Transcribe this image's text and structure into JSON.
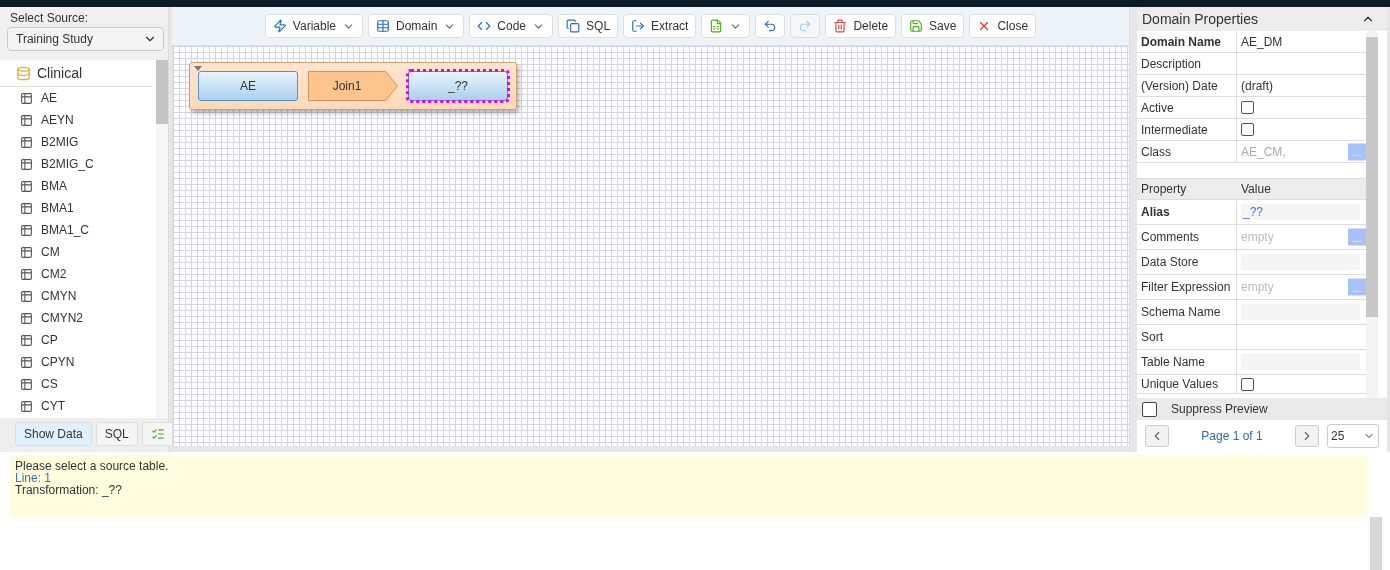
{
  "source": {
    "label": "Select Source:",
    "value": "Training Study",
    "group": "Clinical",
    "tables": [
      "AE",
      "AEYN",
      "B2MIG",
      "B2MIG_C",
      "BMA",
      "BMA1",
      "BMA1_C",
      "CM",
      "CM2",
      "CMYN",
      "CMYN2",
      "CP",
      "CPYN",
      "CS",
      "CYT"
    ],
    "buttons": [
      {
        "label": "Show Data",
        "selected": true
      },
      {
        "label": "SQL",
        "selected": false
      },
      {
        "selected": false
      }
    ]
  },
  "toolbar": [
    {
      "label": "Variable",
      "dropdown": true,
      "disabled": false
    },
    {
      "label": "Domain",
      "dropdown": true,
      "disabled": false
    },
    {
      "label": "Code",
      "dropdown": true,
      "disabled": false
    },
    {
      "label": "SQL",
      "dropdown": false,
      "disabled": false
    },
    {
      "label": "Extract",
      "dropdown": false,
      "disabled": false
    },
    {
      "dropdown": true,
      "disabled": false
    },
    {
      "dropdown": false,
      "disabled": false
    },
    {
      "dropdown": false,
      "disabled": true
    },
    {
      "label": "Delete",
      "dropdown": false,
      "disabled": false
    },
    {
      "label": "Save",
      "dropdown": false,
      "disabled": false
    },
    {
      "label": "Close",
      "dropdown": false,
      "disabled": false
    }
  ],
  "flow": [
    {
      "kind": "table",
      "label": "AE",
      "selected": false
    },
    {
      "kind": "join",
      "label": "Join1",
      "selected": false
    },
    {
      "kind": "table",
      "label": "_??",
      "selected": true
    }
  ],
  "properties": {
    "title": "Domain Properties",
    "expanded": true,
    "domain_rows": [
      {
        "label": "Domain Name",
        "kind": "text",
        "value": "AE_DM",
        "bold": true
      },
      {
        "label": "Description",
        "kind": "text",
        "value": "",
        "bold": false
      },
      {
        "label": "(Version) Date",
        "kind": "text",
        "value": "(draft)",
        "bold": false
      },
      {
        "label": "Active",
        "kind": "checkbox",
        "checked": false,
        "bold": false
      },
      {
        "label": "Intermediate",
        "kind": "checkbox",
        "checked": false,
        "bold": false
      },
      {
        "label": "Class",
        "kind": "lookup",
        "value": "AE_CM,",
        "button": "...",
        "bold": false
      }
    ],
    "columns": [
      "Property",
      "Value"
    ],
    "rows": [
      {
        "label": "Alias",
        "kind": "input",
        "value": "_??",
        "bold": true
      },
      {
        "label": "Comments",
        "kind": "lookup",
        "placeholder": "empty",
        "button": "...",
        "bold": false
      },
      {
        "label": "Data Store",
        "kind": "input",
        "value": "",
        "bold": false
      },
      {
        "label": "Filter Expression",
        "kind": "lookup",
        "placeholder": "empty",
        "button": "...",
        "bold": false
      },
      {
        "label": "Schema Name",
        "kind": "input",
        "value": "",
        "bold": false
      },
      {
        "label": "Sort",
        "kind": "text",
        "value": "",
        "bold": false
      },
      {
        "label": "Table Name",
        "kind": "input",
        "value": "",
        "bold": false
      },
      {
        "label": "Unique Values",
        "kind": "checkbox",
        "checked": false,
        "bold": false
      }
    ],
    "suppress_preview": {
      "label": "Suppress Preview",
      "checked": false
    },
    "pager": {
      "text": "Page 1 of 1",
      "page_size": "25"
    }
  },
  "messages": [
    {
      "kind": "message",
      "text": "Please select a source table."
    },
    {
      "kind": "location",
      "text": "Line: 1"
    },
    {
      "kind": "message",
      "text": "Transformation: _??"
    }
  ]
}
